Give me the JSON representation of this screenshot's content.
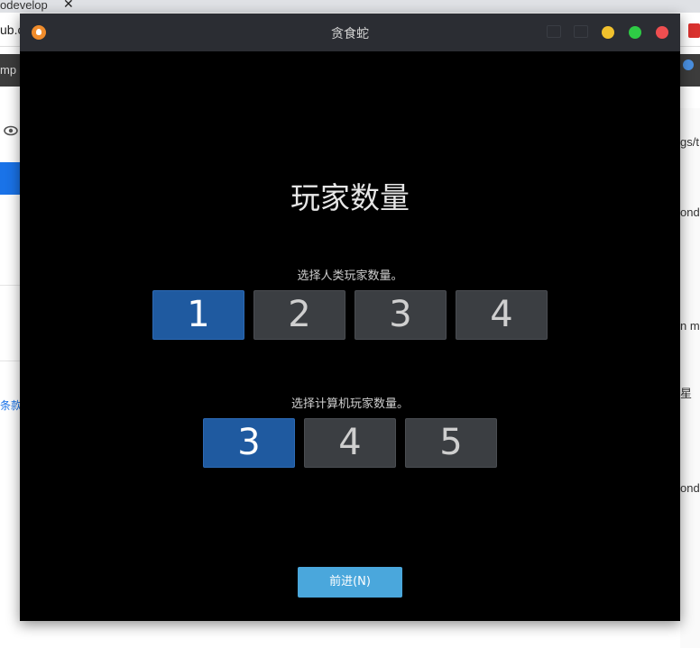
{
  "background": {
    "tab_text": "odevelop",
    "tab_close": "✕",
    "url_text": "ub.c",
    "toolbar_text": "mp",
    "left_link": "条款",
    "right_texts": [
      "gs/t",
      "ond",
      "n m",
      "星",
      "ond"
    ]
  },
  "window": {
    "title": "贪食蛇",
    "heading": "玩家数量",
    "human_label": "选择人类玩家数量。",
    "human_options": [
      "1",
      "2",
      "3",
      "4"
    ],
    "human_selected": "1",
    "cpu_label": "选择计算机玩家数量。",
    "cpu_options": [
      "3",
      "4",
      "5"
    ],
    "cpu_selected": "3",
    "next_button": "前进(N)"
  },
  "colors": {
    "selected": "#1f5aa0",
    "unselected": "#3b3e42",
    "next_button": "#4aa7dc",
    "titlebar": "#2b2d33"
  },
  "icons": {
    "app": "snake-app-icon",
    "minimize": "yellow-dot",
    "maximize": "green-dot",
    "close": "red-dot"
  }
}
